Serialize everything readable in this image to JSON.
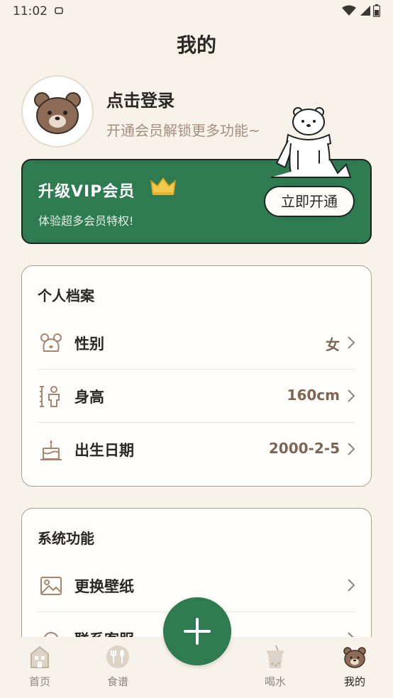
{
  "status_bar": {
    "time": "11:02"
  },
  "header": {
    "title": "我的"
  },
  "profile": {
    "login_title": "点击登录",
    "login_subtitle": "开通会员解锁更多功能~"
  },
  "vip": {
    "title": "升级VIP会员",
    "subtitle": "体验超多会员特权!",
    "button_label": "立即开通",
    "card_color": "#2e7a51"
  },
  "personal": {
    "title": "个人档案",
    "rows": [
      {
        "label": "性别",
        "value": "女",
        "icon": "bear-icon"
      },
      {
        "label": "身高",
        "value": "160cm",
        "icon": "height-icon"
      },
      {
        "label": "出生日期",
        "value": "2000-2-5",
        "icon": "cake-icon"
      }
    ]
  },
  "system": {
    "title": "系统功能",
    "rows": [
      {
        "label": "更换壁纸",
        "icon": "picture-icon"
      },
      {
        "label": "联系客服",
        "icon": "support-icon"
      }
    ]
  },
  "tabbar": {
    "tabs": [
      {
        "label": "首页",
        "icon": "home-icon"
      },
      {
        "label": "食谱",
        "icon": "recipe-icon"
      },
      {
        "label": "喝水",
        "icon": "drink-icon"
      },
      {
        "label": "我的",
        "icon": "bear-icon",
        "active": true
      }
    ],
    "fab_icon": "plus-icon"
  },
  "colors": {
    "accent": "#2e7a51",
    "background": "#f7f3ea",
    "value_text": "#7d6658"
  }
}
